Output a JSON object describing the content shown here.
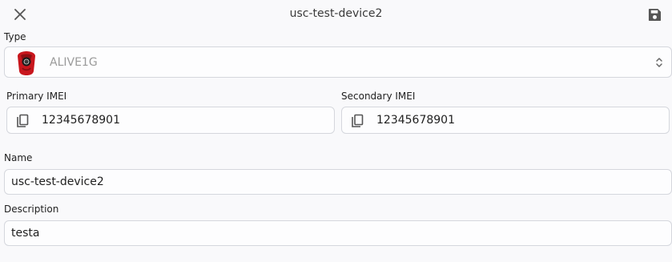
{
  "header": {
    "title": "usc-test-device2",
    "close_icon": "close-icon",
    "save_icon": "save-icon"
  },
  "type": {
    "label": "Type",
    "value": "ALIVE1G",
    "logo_icon": "device-logo-icon",
    "arrows_icon": "select-arrows-icon"
  },
  "primary_imei": {
    "label": "Primary IMEI",
    "value": "12345678901",
    "copy_icon": "copy-icon"
  },
  "secondary_imei": {
    "label": "Secondary IMEI",
    "value": "12345678901",
    "copy_icon": "copy-icon"
  },
  "name": {
    "label": "Name",
    "value": "usc-test-device2"
  },
  "description": {
    "label": "Description",
    "value": "testa"
  },
  "colors": {
    "background": "#f9f9fb",
    "field_border": "#d5d7dd",
    "logo_red": "#c8161d",
    "icon_gray": "#555555"
  }
}
